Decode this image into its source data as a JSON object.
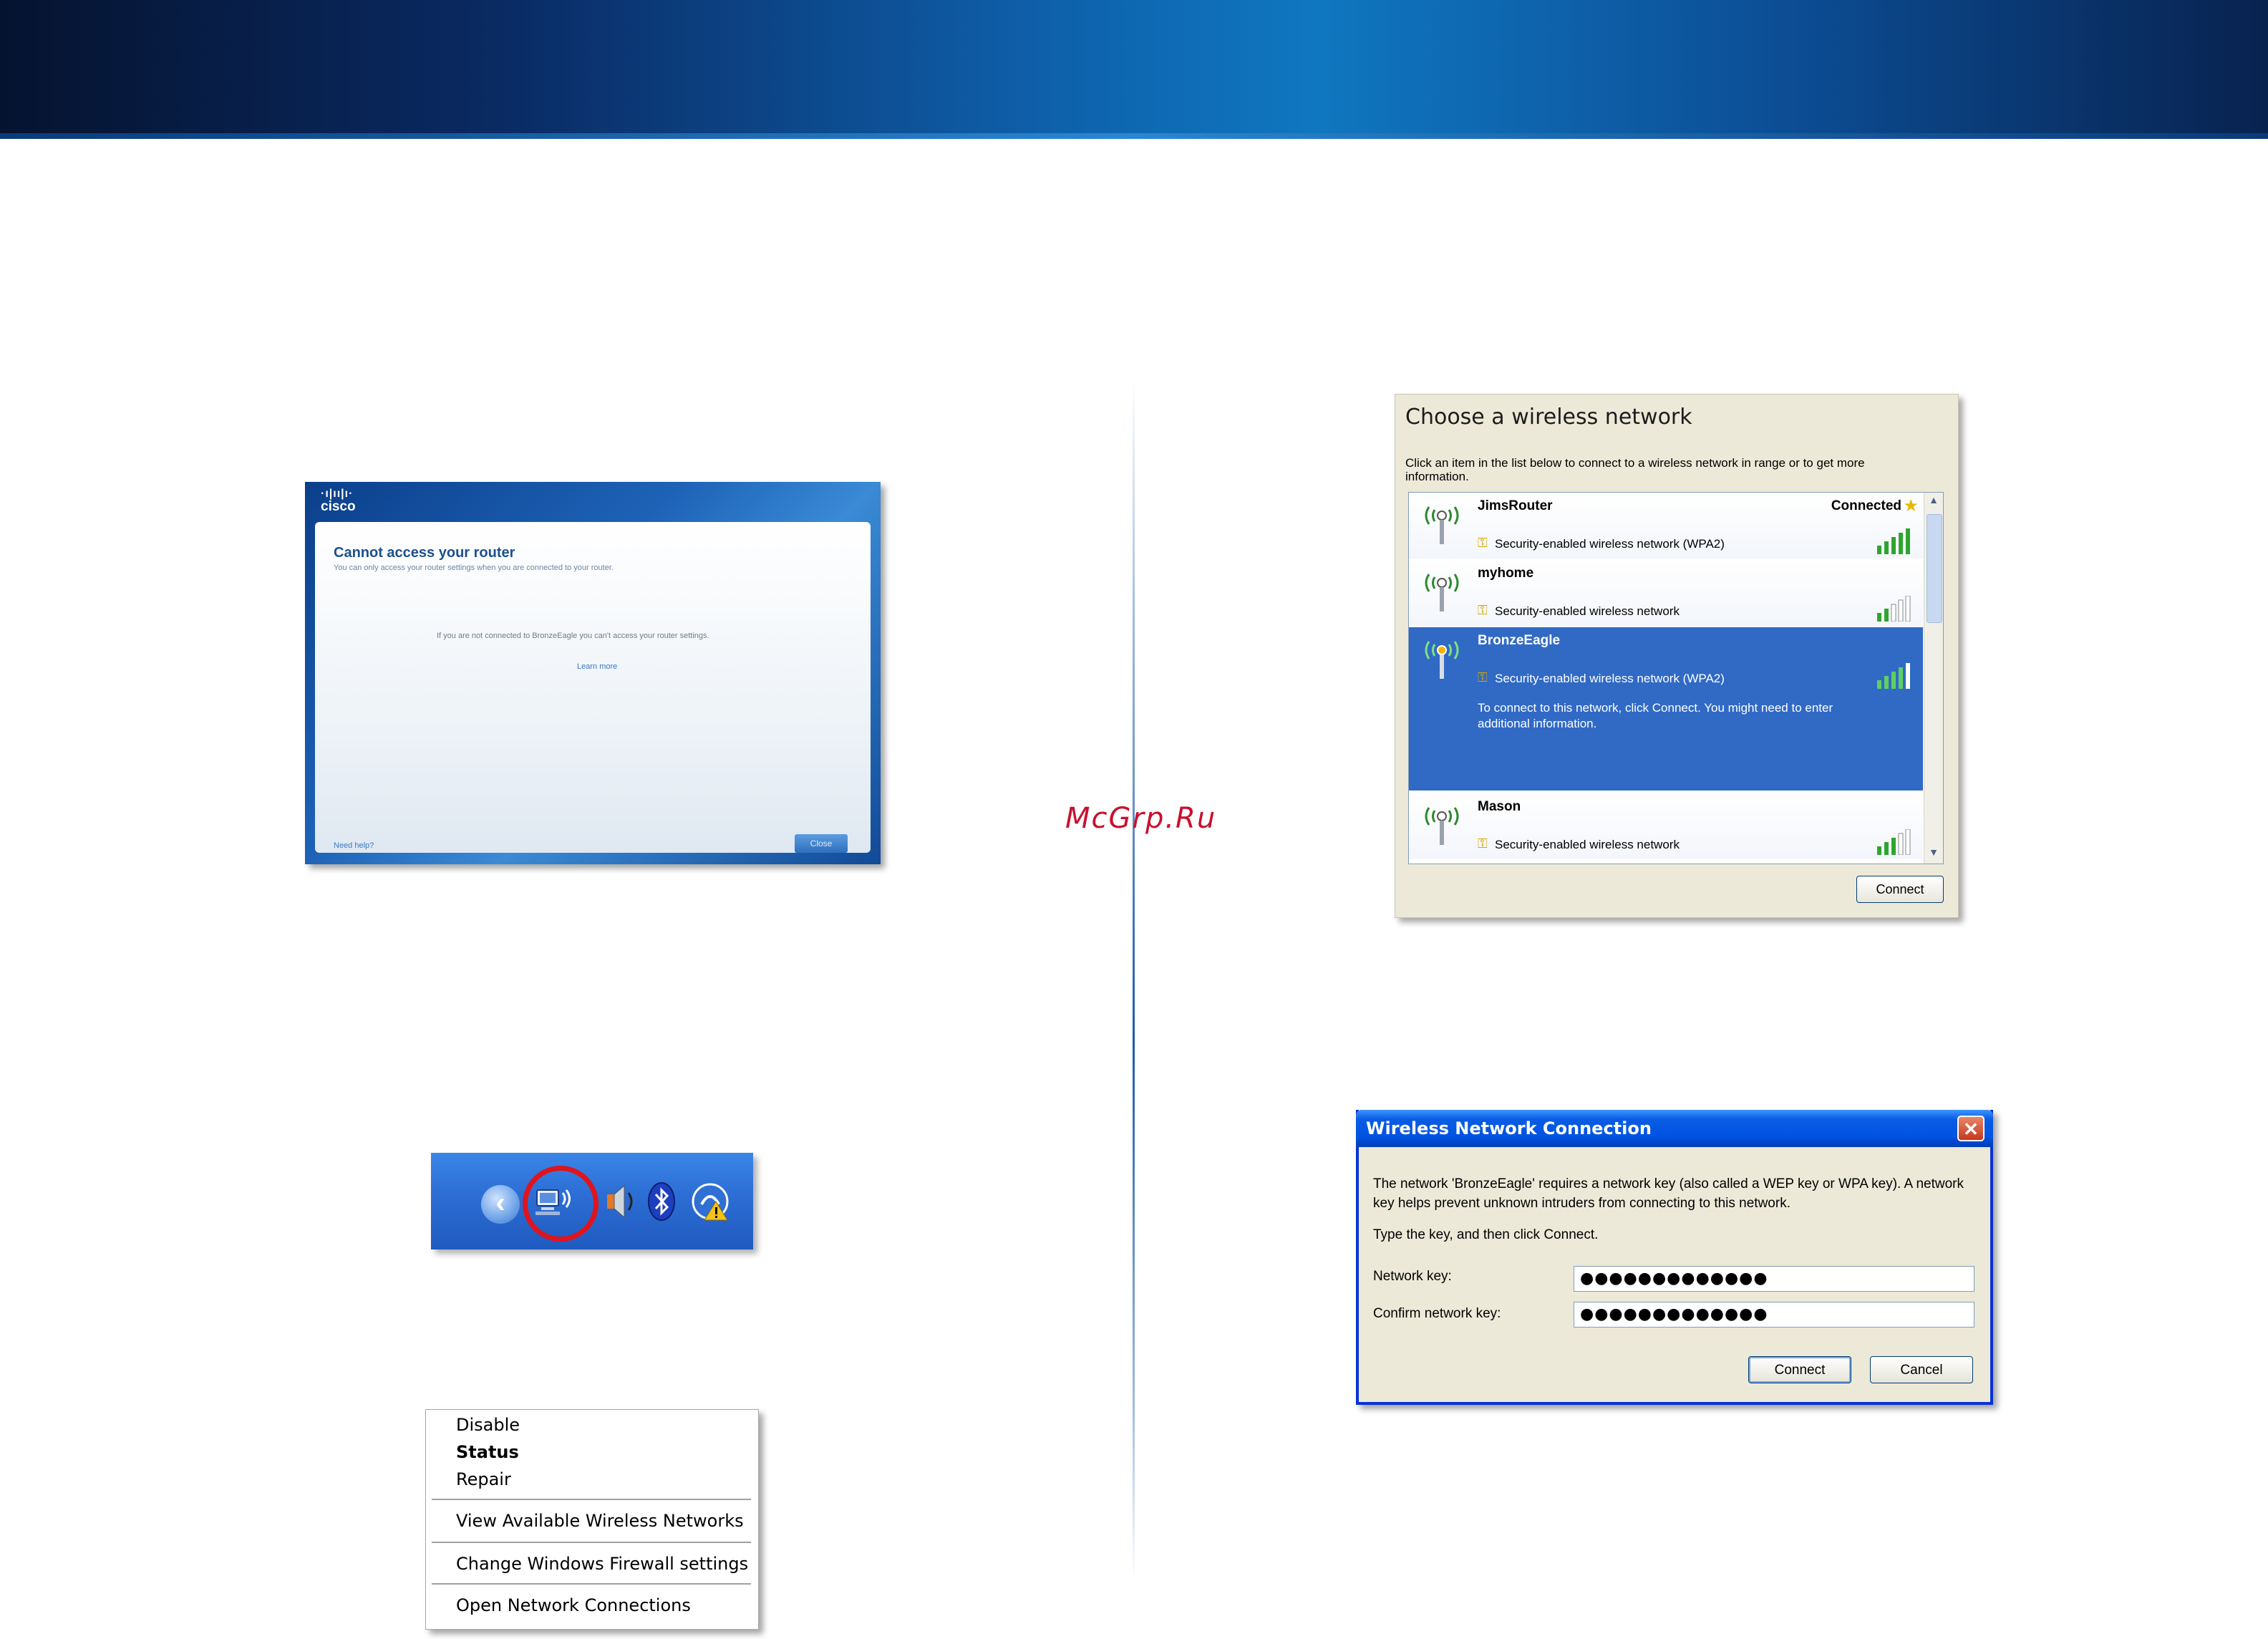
{
  "watermark": "McGrp.Ru",
  "cisco_screen": {
    "logo": "cisco",
    "title": "Cannot access your router",
    "subtitle": "You can only access your router settings when you are connected to your router.",
    "message": "If you are not connected to BronzeEagle you can't access your router settings.",
    "learn_more": "Learn more",
    "help": "Need help?",
    "close": "Close"
  },
  "tray": {
    "icons": [
      "chevron-left-icon",
      "wireless-network-icon",
      "speaker-icon",
      "bluetooth-icon",
      "security-alert-icon"
    ]
  },
  "context_menu": {
    "items": [
      {
        "label": "Disable"
      },
      {
        "label": "Status"
      },
      {
        "label": "Repair"
      },
      {
        "label": "View Available Wireless Networks"
      },
      {
        "label": "Change Windows Firewall settings"
      },
      {
        "label": "Open Network Connections"
      }
    ]
  },
  "choose_network": {
    "title": "Choose a wireless network",
    "description": "Click an item in the list below to connect to a wireless network in range or to get more information.",
    "networks": [
      {
        "name": "JimsRouter",
        "security": "Security-enabled wireless network (WPA2)",
        "status": "Connected"
      },
      {
        "name": "myhome",
        "security": "Security-enabled wireless network"
      },
      {
        "name": "BronzeEagle",
        "security": "Security-enabled wireless network (WPA2)",
        "info": "To connect to this network, click Connect. You might need to enter additional information."
      },
      {
        "name": "Mason",
        "security": "Security-enabled wireless network"
      }
    ],
    "connect": "Connect"
  },
  "wireless_dialog": {
    "title": "Wireless Network Connection",
    "message": "The network 'BronzeEagle' requires a network key (also called a WEP key or WPA key). A network key helps prevent unknown intruders from connecting to this network.",
    "instruction": "Type the key, and then click Connect.",
    "network_key_label": "Network key:",
    "confirm_key_label": "Confirm network key:",
    "network_key_value": "●●●●●●●●●●●●●",
    "confirm_key_value": "●●●●●●●●●●●●●",
    "connect": "Connect",
    "cancel": "Cancel"
  }
}
